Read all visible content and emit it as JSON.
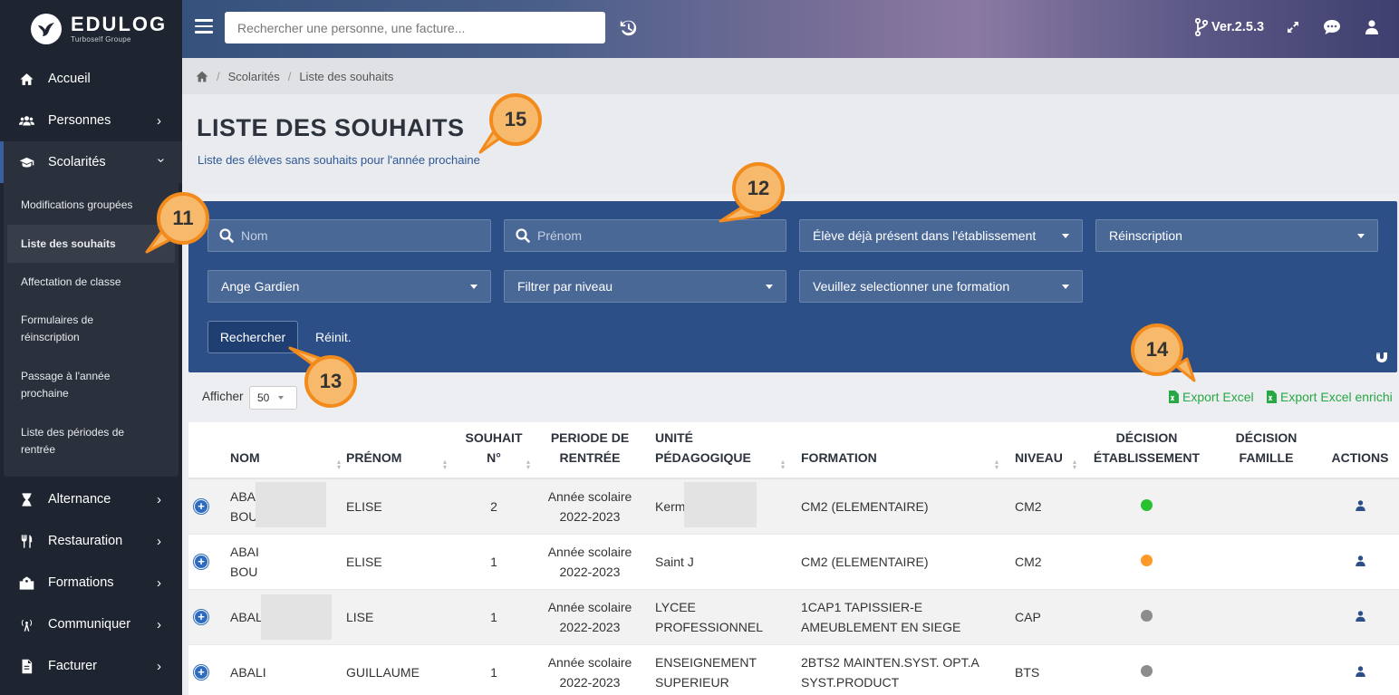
{
  "brand": {
    "name": "EDULOG",
    "subtitle": "Turboself Groupe"
  },
  "sidebar": {
    "items": [
      {
        "label": "Accueil",
        "icon": "home-icon"
      },
      {
        "label": "Personnes",
        "icon": "users-icon"
      },
      {
        "label": "Scolarités",
        "icon": "graduation-cap-icon"
      },
      {
        "label": "Alternance",
        "icon": "hourglass-icon"
      },
      {
        "label": "Restauration",
        "icon": "utensils-icon"
      },
      {
        "label": "Formations",
        "icon": "school-icon"
      },
      {
        "label": "Communiquer",
        "icon": "broadcast-icon"
      },
      {
        "label": "Facturer",
        "icon": "invoice-icon"
      }
    ],
    "submenu": [
      {
        "line1": "Modifications groupées",
        "line2": ""
      },
      {
        "line1": "Liste des souhaits",
        "line2": ""
      },
      {
        "line1": "Affectation de classe",
        "line2": ""
      },
      {
        "line1": "Formulaires de",
        "line2": "réinscription"
      },
      {
        "line1": "Passage à l'année",
        "line2": "prochaine"
      },
      {
        "line1": "Liste des périodes de",
        "line2": "rentrée"
      }
    ]
  },
  "header": {
    "search_placeholder": "Rechercher une personne, une facture...",
    "version": "Ver.2.5.3"
  },
  "breadcrumb": {
    "item1": "Scolarités",
    "item2": "Liste des souhaits",
    "sep": "/"
  },
  "page": {
    "title": "LISTE DES SOUHAITS",
    "subtitle": "Liste des élèves sans souhaits pour l'année prochaine"
  },
  "filters": {
    "nom_placeholder": "Nom",
    "prenom_placeholder": "Prénom",
    "eleve_present": "Élève déjà présent dans l'établissement",
    "reinscription": "Réinscription",
    "ange_gardien": "Ange Gardien",
    "niveau": "Filtrer par niveau",
    "formation": "Veuillez selectionner une formation",
    "search_btn": "Rechercher",
    "reset_btn": "Réinit."
  },
  "callouts": {
    "c11": "11",
    "c12": "12",
    "c13": "13",
    "c14": "14",
    "c15": "15"
  },
  "table_controls": {
    "show_label": "Afficher",
    "show_value": "50",
    "export_excel": "Export Excel",
    "export_enriched": "Export Excel enrichi"
  },
  "table": {
    "headers": {
      "nom": "NOM",
      "prenom": "PRÉNOM",
      "souhait_1": "SOUHAIT",
      "souhait_2": "N°",
      "periode_1": "PERIODE DE",
      "periode_2": "RENTRÉE",
      "unite_1": "UNITÉ",
      "unite_2": "PÉDAGOGIQUE",
      "formation": "FORMATION",
      "niveau": "NIVEAU",
      "decision_etab_1": "DÉCISION",
      "decision_etab_2": "ÉTABLISSEMENT",
      "decision_fam_1": "DÉCISION",
      "decision_fam_2": "FAMILLE",
      "actions": "ACTIONS"
    },
    "rows": [
      {
        "nom1": "ABA",
        "nom2": "BOU",
        "prenom": "ELISE",
        "souhait": "2",
        "periode1": "Année scolaire",
        "periode2": "2022-2023",
        "unite1": "Kerm",
        "unite2": "",
        "formation1": "CM2 (ELEMENTAIRE)",
        "formation2": "",
        "niveau": "CM2",
        "decision_color": "#28c12f"
      },
      {
        "nom1": "ABAI",
        "nom2": "BOU",
        "prenom": "ELISE",
        "souhait": "1",
        "periode1": "Année scolaire",
        "periode2": "2022-2023",
        "unite1": "Saint J",
        "unite2": "",
        "formation1": "CM2 (ELEMENTAIRE)",
        "formation2": "",
        "niveau": "CM2",
        "decision_color": "#fd9a2a"
      },
      {
        "nom1": "ABAL",
        "nom2": "",
        "prenom": "LISE",
        "souhait": "1",
        "periode1": "Année scolaire",
        "periode2": "2022-2023",
        "unite1": "LYCEE",
        "unite2": "PROFESSIONNEL",
        "formation1": "1CAP1 TAPISSIER-E",
        "formation2": "AMEUBLEMENT EN SIEGE",
        "niveau": "CAP",
        "decision_color": "#8c8c8c"
      },
      {
        "nom1": "ABALI",
        "nom2": "",
        "prenom": "GUILLAUME",
        "souhait": "1",
        "periode1": "Année scolaire",
        "periode2": "2022-2023",
        "unite1": "ENSEIGNEMENT",
        "unite2": "SUPERIEUR",
        "formation1": "2BTS2 MAINTEN.SYST. OPT.A",
        "formation2": "SYST.PRODUCT",
        "niveau": "BTS",
        "decision_color": "#8c8c8c"
      }
    ]
  },
  "colors": {
    "sidebar": "#1f2530",
    "filter_panel": "#2d4f87",
    "callout_border": "#f28b1c",
    "export": "#28a745"
  }
}
